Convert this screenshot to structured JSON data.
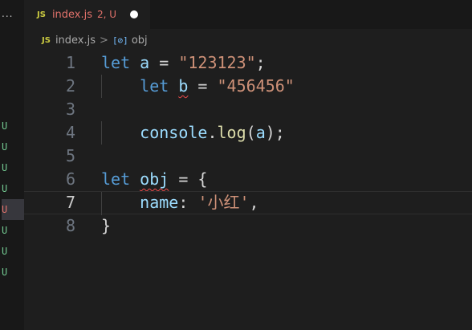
{
  "gutter": {
    "dots": "...",
    "scm_marks": [
      {
        "label": "U",
        "active": false
      },
      {
        "label": "U",
        "active": false
      },
      {
        "label": "U",
        "active": false
      },
      {
        "label": "U",
        "active": false
      },
      {
        "label": "U",
        "active": true
      },
      {
        "label": "U",
        "active": false
      },
      {
        "label": "U",
        "active": false
      },
      {
        "label": "U",
        "active": false
      }
    ]
  },
  "tab": {
    "icon_text": "JS",
    "filename": "index.js",
    "status": "2, U",
    "dirty": true
  },
  "breadcrumb": {
    "file_icon_text": "JS",
    "file": "index.js",
    "separator": ">",
    "symbol_icon_text": "[⊘]",
    "symbol": "obj"
  },
  "editor": {
    "current_line": 7,
    "lines": [
      {
        "number": "1",
        "tokens": [
          [
            "kw",
            "let"
          ],
          [
            "punc",
            " "
          ],
          [
            "var",
            "a"
          ],
          [
            "punc",
            " = "
          ],
          [
            "str",
            "\"123123\""
          ],
          [
            "punc",
            ";"
          ]
        ]
      },
      {
        "number": "2",
        "tokens": [
          [
            "punc",
            "    "
          ],
          [
            "kw",
            "let"
          ],
          [
            "punc",
            " "
          ],
          [
            "var squig",
            "b"
          ],
          [
            "punc",
            " = "
          ],
          [
            "str",
            "\"456456\""
          ]
        ]
      },
      {
        "number": "3",
        "tokens": []
      },
      {
        "number": "4",
        "tokens": [
          [
            "punc",
            "    "
          ],
          [
            "var",
            "console"
          ],
          [
            "punc",
            "."
          ],
          [
            "fn",
            "log"
          ],
          [
            "punc",
            "("
          ],
          [
            "var",
            "a"
          ],
          [
            "punc",
            ");"
          ]
        ]
      },
      {
        "number": "5",
        "tokens": []
      },
      {
        "number": "6",
        "tokens": [
          [
            "kw",
            "let"
          ],
          [
            "punc",
            " "
          ],
          [
            "var squig",
            "obj"
          ],
          [
            "punc",
            " = {"
          ]
        ]
      },
      {
        "number": "7",
        "tokens": [
          [
            "punc",
            "    "
          ],
          [
            "obj",
            "name"
          ],
          [
            "punc",
            ": "
          ],
          [
            "str",
            "'小红'"
          ],
          [
            "punc",
            ","
          ]
        ]
      },
      {
        "number": "8",
        "tokens": [
          [
            "punc",
            "}"
          ]
        ]
      }
    ]
  },
  "colors": {
    "background": "#1e1e1e",
    "keyword": "#569cd6",
    "variable": "#9cdcfe",
    "string": "#ce9178",
    "function": "#dcdcaa",
    "untracked": "#73c991",
    "error": "#e2726b"
  }
}
